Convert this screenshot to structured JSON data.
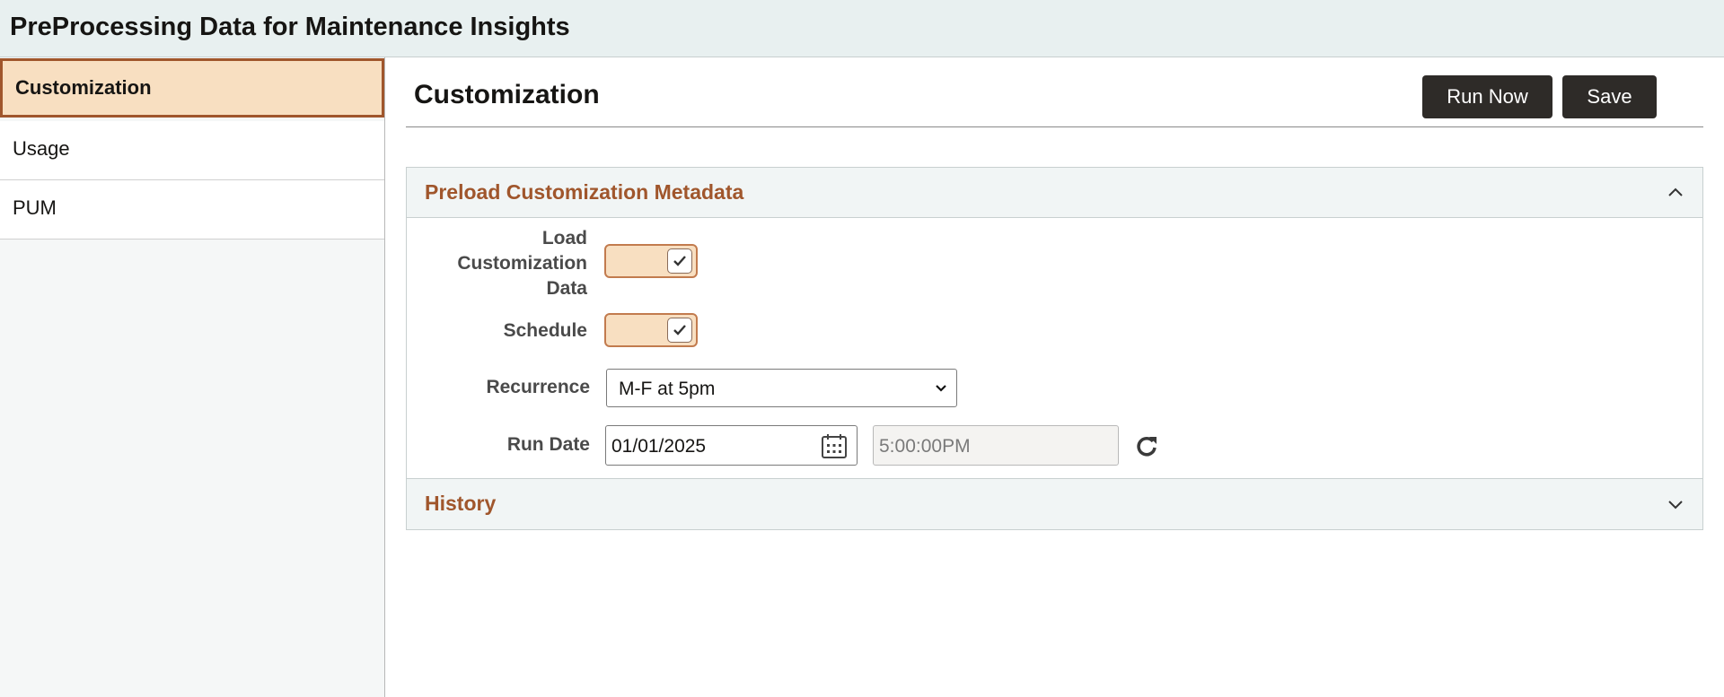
{
  "app": {
    "title": "PreProcessing Data for Maintenance Insights"
  },
  "sidebar": {
    "items": [
      {
        "label": "Customization",
        "active": true
      },
      {
        "label": "Usage",
        "active": false
      },
      {
        "label": "PUM",
        "active": false
      }
    ]
  },
  "main": {
    "title": "Customization",
    "actions": {
      "run_now": "Run Now",
      "save": "Save"
    },
    "sections": [
      {
        "title": "Preload Customization Metadata",
        "expanded": true,
        "icon": "chevron-up-icon"
      },
      {
        "title": "History",
        "expanded": false,
        "icon": "chevron-down-icon"
      }
    ],
    "form": {
      "load_customization_data": {
        "label_line1": "Load",
        "label_line2": "Customization",
        "label_line3": "Data",
        "checked": true
      },
      "schedule": {
        "label": "Schedule",
        "checked": true
      },
      "recurrence": {
        "label": "Recurrence",
        "value": "M-F at 5pm"
      },
      "run_date": {
        "label": "Run Date",
        "date": "01/01/2025",
        "time": "5:00:00PM"
      }
    }
  },
  "colors": {
    "accent": "#a0562c",
    "toggle_bg": "#f8dfc1",
    "button_bg": "#2e2b28",
    "header_bg": "#e8f0f0"
  }
}
